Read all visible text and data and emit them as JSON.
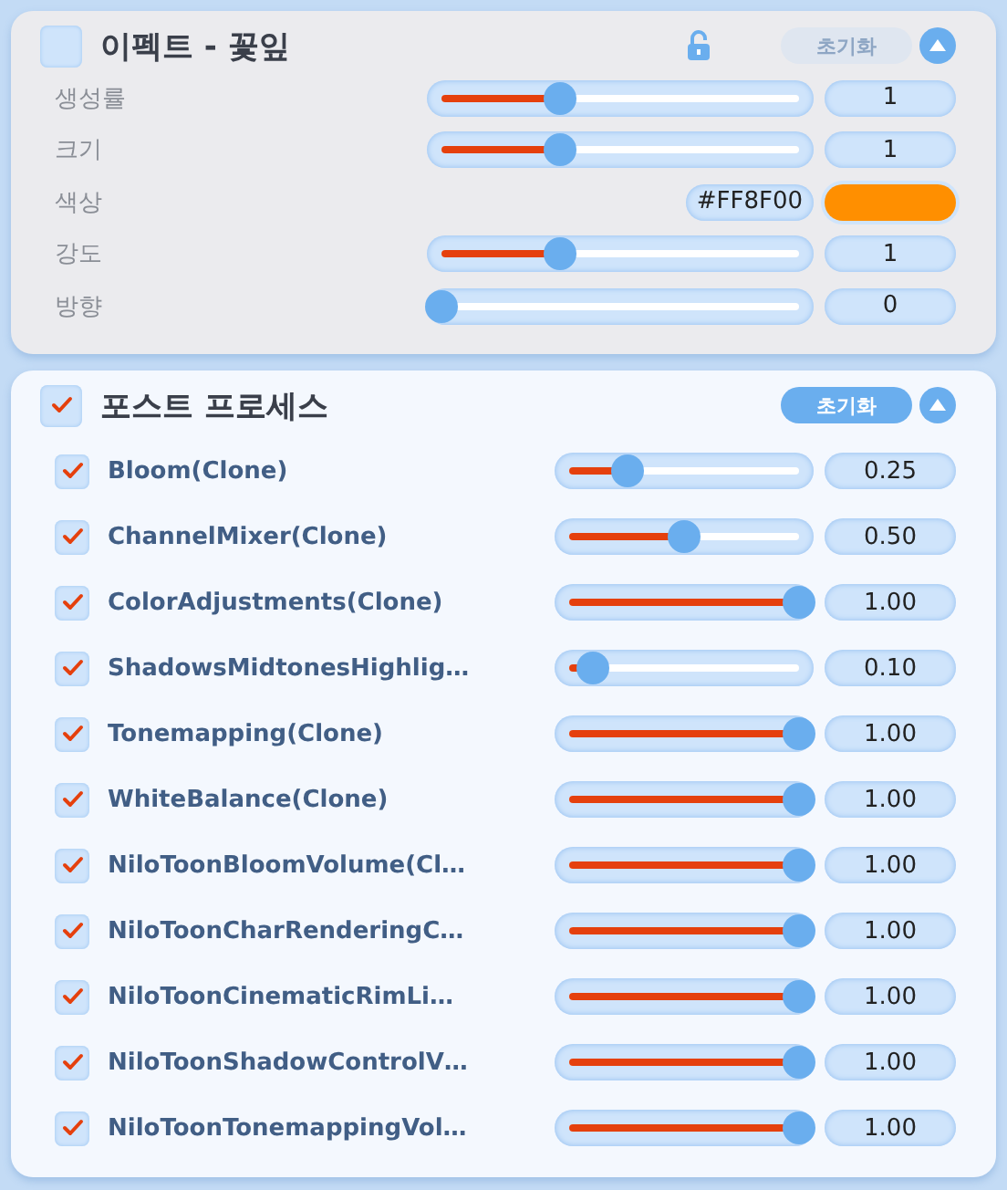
{
  "effect_panel": {
    "checkbox": {
      "checked": false
    },
    "title": "이펙트 - 꽃잎",
    "lock": {
      "locked": false
    },
    "reset_button": {
      "label": "초기화",
      "disabled": true
    },
    "collapse": {
      "expanded": true
    },
    "properties": [
      {
        "kind": "slider",
        "label": "생성률",
        "level": 0.33,
        "value": "1"
      },
      {
        "kind": "slider",
        "label": "크기",
        "level": 0.33,
        "value": "1"
      },
      {
        "kind": "color",
        "label": "색상",
        "hex": "#FF8F00",
        "color": "#ff8f00"
      },
      {
        "kind": "slider",
        "label": "강도",
        "level": 0.33,
        "value": "1"
      },
      {
        "kind": "slider",
        "label": "방향",
        "level": 0,
        "value": "0"
      }
    ]
  },
  "post_process_panel": {
    "checkbox": {
      "checked": true
    },
    "title": "포스트 프로세스",
    "reset_button": {
      "label": "초기화",
      "disabled": false
    },
    "collapse": {
      "expanded": true
    },
    "effects": [
      {
        "name": "Bloom(Clone)",
        "checked": true,
        "level": 0.25,
        "value": "0.25"
      },
      {
        "name": "ChannelMixer(Clone)",
        "checked": true,
        "level": 0.5,
        "value": "0.50"
      },
      {
        "name": "ColorAdjustments(Clone)",
        "checked": true,
        "level": 1,
        "value": "1.00"
      },
      {
        "name": "ShadowsMidtonesHighlig…",
        "checked": true,
        "level": 0.1,
        "value": "0.10"
      },
      {
        "name": "Tonemapping(Clone)",
        "checked": true,
        "level": 1,
        "value": "1.00"
      },
      {
        "name": "WhiteBalance(Clone)",
        "checked": true,
        "level": 1,
        "value": "1.00"
      },
      {
        "name": "NiloToonBloomVolume(Cl…",
        "checked": true,
        "level": 1,
        "value": "1.00"
      },
      {
        "name": "NiloToonCharRenderingC…",
        "checked": true,
        "level": 1,
        "value": "1.00"
      },
      {
        "name": "NiloToonCinematicRimLi…",
        "checked": true,
        "level": 1,
        "value": "1.00"
      },
      {
        "name": "NiloToonShadowControlV…",
        "checked": true,
        "level": 1,
        "value": "1.00"
      },
      {
        "name": "NiloToonTonemappingVol…",
        "checked": true,
        "level": 1,
        "value": "1.00"
      }
    ]
  }
}
